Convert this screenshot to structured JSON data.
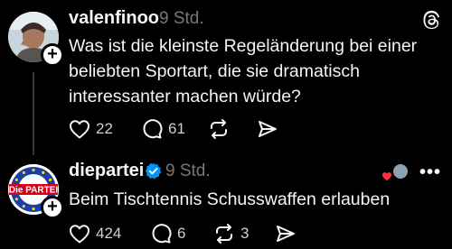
{
  "post1": {
    "username": "valenfinoo",
    "time": "9 Std.",
    "text": "Was ist die kleinste Regeländerung bei einer beliebten Sportart, die sie dramatisch interessanter machen würde?",
    "likes": "22",
    "replies": "61"
  },
  "post2": {
    "username": "diepartei",
    "time": "9 Std.",
    "avatar_text": "Die PARTEI",
    "text": "Beim Tischtennis Schusswaffen erlauben",
    "likes": "424",
    "replies": "6",
    "reposts": "3"
  },
  "icons": {
    "like": "heart-icon",
    "reply": "speech-bubble-icon",
    "repost": "repost-icon",
    "share": "paper-plane-icon",
    "app": "threads-logo-icon",
    "more": "more-dots-icon"
  },
  "colors": {
    "background": "#000000",
    "text": "#f3f5f7",
    "muted": "#777777",
    "verified": "#0095f6",
    "party_red": "#d6001c",
    "party_blue": "#1a3ea8"
  }
}
